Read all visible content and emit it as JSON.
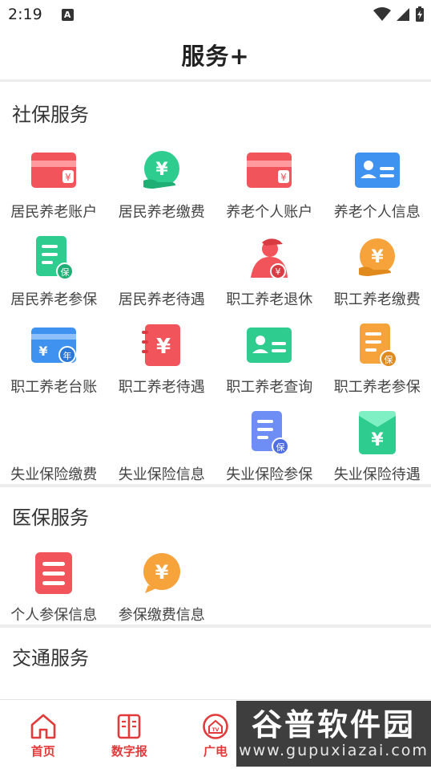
{
  "status_bar": {
    "time": "2:19",
    "notification_icon": "A"
  },
  "header": {
    "title": "服务+"
  },
  "sections": [
    {
      "title": "社保服务",
      "items": [
        {
          "label": "居民养老账户",
          "icon": "red-card-yuan-icon"
        },
        {
          "label": "居民养老缴费",
          "icon": "green-hand-yuan-icon"
        },
        {
          "label": "养老个人账户",
          "icon": "red-card-yuan-icon"
        },
        {
          "label": "养老个人信息",
          "icon": "blue-id-card-icon"
        },
        {
          "label": "居民养老参保",
          "icon": "green-document-bao-icon"
        },
        {
          "label": "居民养老待遇",
          "icon": ""
        },
        {
          "label": "职工养老退休",
          "icon": "red-person-yuan-icon"
        },
        {
          "label": "职工养老缴费",
          "icon": "orange-hand-yuan-icon"
        },
        {
          "label": "职工养老台账",
          "icon": "blue-card-nian-icon"
        },
        {
          "label": "职工养老待遇",
          "icon": "red-notebook-yuan-icon"
        },
        {
          "label": "职工养老查询",
          "icon": "green-id-card-icon"
        },
        {
          "label": "职工养老参保",
          "icon": "orange-document-bao-icon"
        },
        {
          "label": "失业保险缴费",
          "icon": ""
        },
        {
          "label": "失业保险信息",
          "icon": ""
        },
        {
          "label": "失业保险参保",
          "icon": "blue-document-bao-icon"
        },
        {
          "label": "失业保险待遇",
          "icon": "green-envelope-yuan-icon"
        }
      ]
    },
    {
      "title": "医保服务",
      "items": [
        {
          "label": "个人参保信息",
          "icon": "red-list-document-icon"
        },
        {
          "label": "参保缴费信息",
          "icon": "orange-speech-yuan-icon"
        }
      ]
    },
    {
      "title": "交通服务",
      "items": []
    }
  ],
  "glyphs": {
    "yuan": "¥",
    "bao": "保",
    "nian": "年",
    "tv": "TV"
  },
  "bottom_nav": [
    {
      "label": "首页",
      "icon": "home-icon"
    },
    {
      "label": "数字报",
      "icon": "newspaper-icon"
    },
    {
      "label": "广电",
      "icon": "tv-house-icon"
    }
  ],
  "watermark": {
    "main": "谷普软件园",
    "sub": "www.gupuxiazai.com"
  },
  "colors": {
    "accent_red": "#e23a3a",
    "card_red": "#f2545b",
    "green": "#2ecc8e",
    "blue": "#3f92f0",
    "orange": "#f7a33c",
    "divider": "#ededed"
  }
}
